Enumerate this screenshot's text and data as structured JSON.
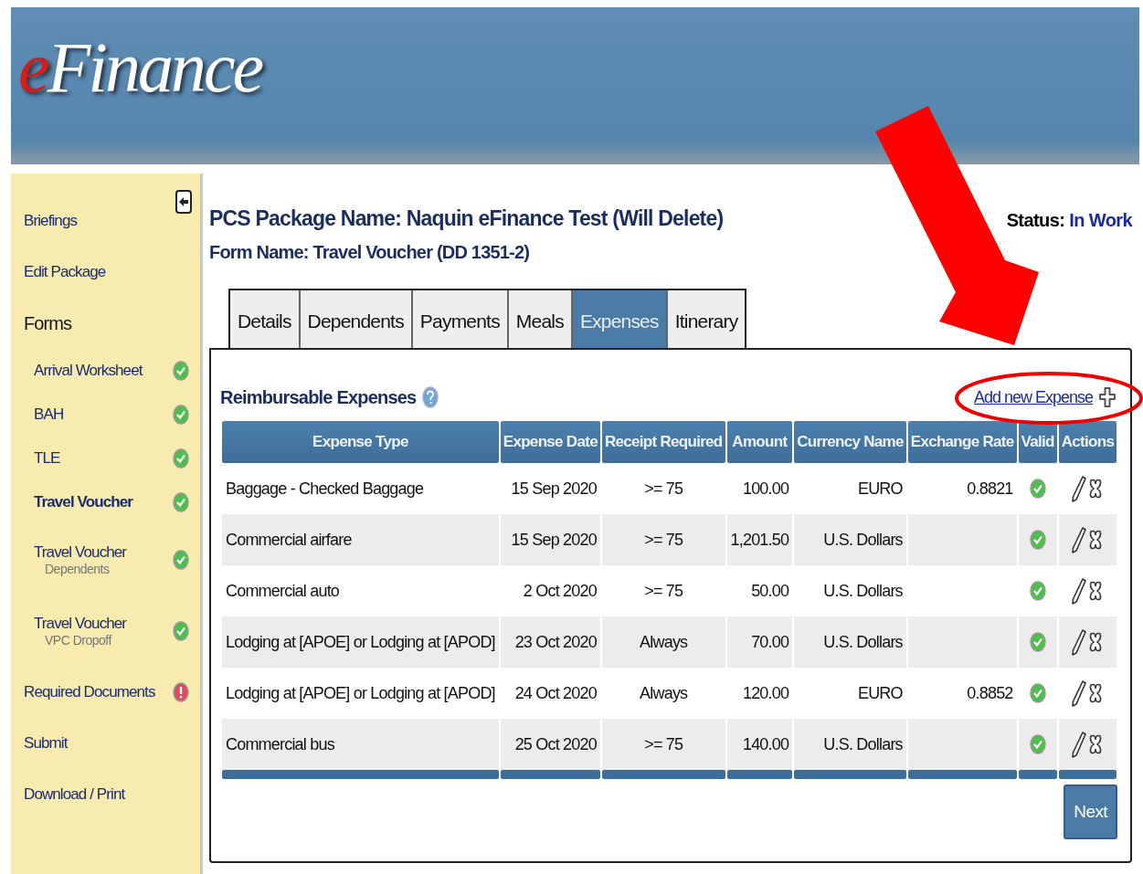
{
  "header": {
    "logo_accent": "e",
    "logo_rest": "Finance"
  },
  "sidebar": {
    "items": [
      {
        "label": "Briefings",
        "kind": "link",
        "selected": false
      },
      {
        "label": "Edit Package",
        "kind": "link",
        "selected": false
      },
      {
        "label": "Forms",
        "kind": "heading",
        "selected": false,
        "children": [
          {
            "label": "Arrival Worksheet",
            "valid": true,
            "selected": false
          },
          {
            "label": "BAH",
            "valid": true,
            "selected": false
          },
          {
            "label": "TLE",
            "valid": true,
            "selected": false
          },
          {
            "label": "Travel Voucher",
            "valid": true,
            "selected": true
          },
          {
            "label": "Travel Voucher",
            "sublabel": "Dependents",
            "valid": true,
            "selected": false
          },
          {
            "label": "Travel Voucher",
            "sublabel": "VPC Dropoff",
            "valid": true,
            "selected": false
          }
        ]
      },
      {
        "label": "Required Documents",
        "kind": "link",
        "valid": false,
        "selected": false
      },
      {
        "label": "Submit",
        "kind": "link",
        "selected": false
      },
      {
        "label": "Download / Print",
        "kind": "link",
        "selected": false
      }
    ]
  },
  "package_title": "PCS Package Name: Naquin eFinance Test (Will Delete)",
  "form_title": "Form Name: Travel Voucher (DD 1351-2)",
  "status": {
    "label": "Status:",
    "value": "In Work"
  },
  "tabs": [
    {
      "label": "Details",
      "selected": false
    },
    {
      "label": "Dependents",
      "selected": false
    },
    {
      "label": "Payments",
      "selected": false
    },
    {
      "label": "Meals",
      "selected": false
    },
    {
      "label": "Expenses",
      "selected": true
    },
    {
      "label": "Itinerary",
      "selected": false
    }
  ],
  "panel": {
    "title": "Reimbursable Expenses",
    "add_link": "Add new Expense",
    "table": {
      "columns": [
        "Expense Type",
        "Expense Date",
        "Receipt Required",
        "Amount",
        "Currency Name",
        "Exchange Rate",
        "Valid",
        "Actions"
      ],
      "rows": [
        {
          "type": "Baggage - Checked Baggage",
          "date": "15 Sep 2020",
          "receipt": ">= 75",
          "amount": "100.00",
          "currency": "EURO",
          "rate": "0.8821",
          "valid": true
        },
        {
          "type": "Commercial airfare",
          "date": "15 Sep 2020",
          "receipt": ">= 75",
          "amount": "1,201.50",
          "currency": "U.S. Dollars",
          "valid": true
        },
        {
          "type": "Commercial auto",
          "date": "2 Oct 2020",
          "receipt": ">= 75",
          "amount": "50.00",
          "currency": "U.S. Dollars",
          "valid": true
        },
        {
          "type": "Lodging at [APOE] or Lodging at [APOD]",
          "date": "23 Oct 2020",
          "receipt": "Always",
          "amount": "70.00",
          "currency": "U.S. Dollars",
          "valid": true
        },
        {
          "type": "Lodging at [APOE] or Lodging at [APOD]",
          "date": "24 Oct 2020",
          "receipt": "Always",
          "amount": "120.00",
          "currency": "EURO",
          "rate": "0.8852",
          "valid": true
        },
        {
          "type": "Commercial bus",
          "date": "25 Oct 2020",
          "receipt": ">= 75",
          "amount": "140.00",
          "currency": "U.S. Dollars",
          "valid": true
        }
      ]
    },
    "next_button": "Next"
  }
}
